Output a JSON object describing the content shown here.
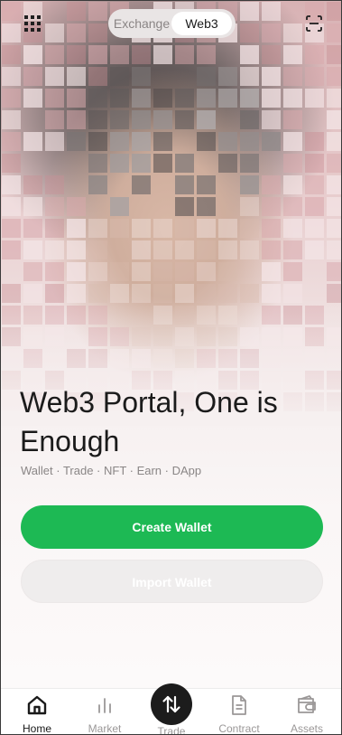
{
  "top_bar": {
    "menu_icon": "grid-icon",
    "tabs": [
      {
        "label": "Exchange",
        "active": false
      },
      {
        "label": "Web3",
        "active": true
      }
    ],
    "scan_icon": "scan-icon"
  },
  "hero": {
    "headline": "Web3 Portal, One is Enough",
    "features": "Wallet · Trade · NFT · Earn · DApp"
  },
  "actions": {
    "create_wallet": "Create Wallet",
    "import_wallet": "Import Wallet"
  },
  "bottom_nav": {
    "items": [
      {
        "label": "Home",
        "icon": "home-icon",
        "active": true
      },
      {
        "label": "Market",
        "icon": "market-icon",
        "active": false
      },
      {
        "label": "Trade",
        "icon": "trade-icon",
        "active": false
      },
      {
        "label": "Contract",
        "icon": "contract-icon",
        "active": false
      },
      {
        "label": "Assets",
        "icon": "assets-icon",
        "active": false
      }
    ]
  },
  "colors": {
    "accent": "#1db954",
    "text_primary": "#1b1b1b",
    "text_secondary": "#8a8686"
  }
}
